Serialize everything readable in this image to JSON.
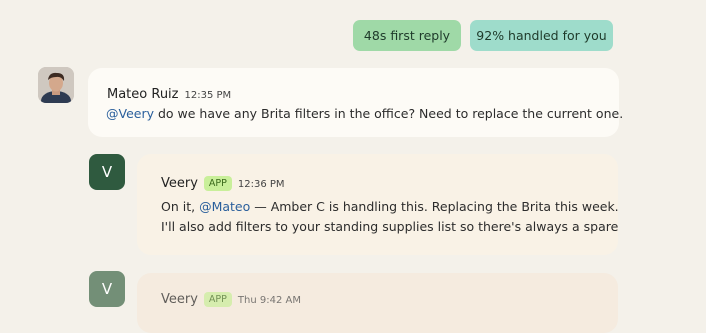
{
  "badges": {
    "first_reply": "48s first reply",
    "handled": "92% handled for you"
  },
  "messages": [
    {
      "author": "Mateo Ruiz",
      "time": "12:35 PM",
      "mention": "@Veery",
      "text": " do we have any Brita filters in the office? Need to replace the current one."
    },
    {
      "avatar_letter": "V",
      "author": "Veery",
      "tag": "APP",
      "time": "12:36 PM",
      "prefix": "On it, ",
      "mention": "@Mateo",
      "line1_rest": " — Amber C is handling this. Replacing the Brita this week.",
      "line2": "I'll also add filters to your standing supplies list so there's always a spare"
    },
    {
      "avatar_letter": "V",
      "author": "Veery",
      "tag": "APP",
      "time": "Thu 9:42 AM"
    }
  ],
  "colors": {
    "background": "#f4f1ea",
    "badge_green": "#9fd9a7",
    "badge_teal": "#9edccb",
    "veery_avatar": "#2f5a3f",
    "app_tag": "#c9ef9a",
    "mention": "#2a5f9c"
  }
}
